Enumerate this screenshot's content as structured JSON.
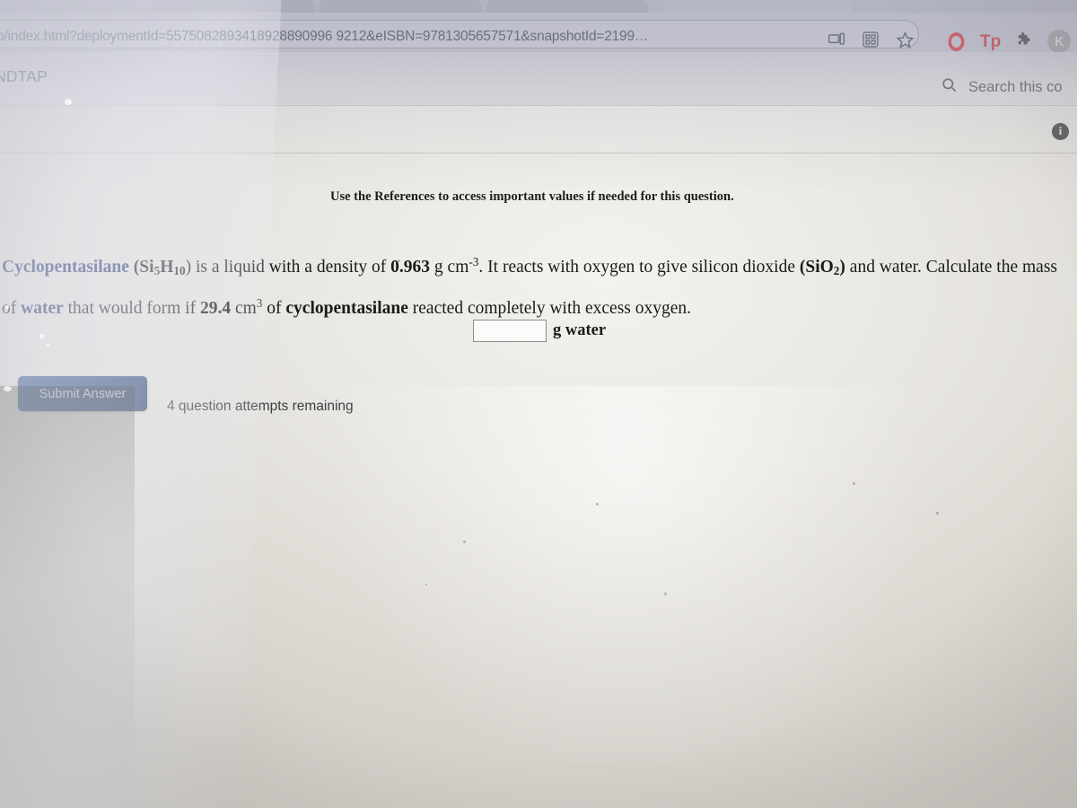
{
  "browser": {
    "url": "o/index.html?deploymentId=5575082893418928890996 9212&eISBN=9781305657571&snapshotId=2199…",
    "omnibox_icons": [
      {
        "name": "cast-device-icon",
        "glyph": "cast"
      },
      {
        "name": "qr-code-icon",
        "glyph": "qr"
      },
      {
        "name": "bookmark-star-icon",
        "glyph": "star"
      }
    ],
    "extension_icons": [
      {
        "name": "opera-logo-icon",
        "label": "O",
        "color": "#d8232a"
      },
      {
        "name": "tp-extension-icon",
        "label": "Tp",
        "color": "#cf2027"
      },
      {
        "name": "extensions-puzzle-icon",
        "label": "puzzle"
      }
    ],
    "profile_avatar": {
      "initial": "K",
      "color": "#9b9b9b"
    }
  },
  "app_header": {
    "brand": "NDTAP",
    "search_label": "Search this co",
    "search_icon": "search-icon",
    "info_badge": "i"
  },
  "question": {
    "instruction": "Use the References to access important values if needed for this question.",
    "statement_parts": {
      "compound_name": "Cyclopentasilane",
      "formula_lead": "(Si",
      "formula_sub1": "5",
      "formula_mid": "H",
      "formula_sub2": "10",
      "formula_tail": ") is a liquid with a density of ",
      "density_value": "0.963",
      "density_unit_prefix": " g cm",
      "density_unit_exp": "-3",
      "reaction_text": ". It reacts with oxygen to give silicon dioxide ",
      "product_formula_lead": "(SiO",
      "product_sub": "2",
      "product_tail": ")",
      "reaction_text2": " and water. Calculate the mass of ",
      "water_word": "water",
      "line2_a": " that would form if ",
      "volume_value": "29.4",
      "volume_unit_prefix": " cm",
      "volume_unit_exp": "3",
      "line2_b": " of ",
      "compound_inline": "cyclopentasilane",
      "line2_c": " reacted completely with excess oxygen."
    },
    "answer_value": "",
    "answer_placeholder": "",
    "answer_unit": "g water",
    "submit_label": "Submit Answer",
    "attempts_text": "4 question attempts remaining"
  },
  "colors": {
    "submit_button": "#2d4a7d",
    "term_highlight": "#24356b",
    "opera_red": "#d8232a",
    "info_badge": "#4a4a4a"
  }
}
